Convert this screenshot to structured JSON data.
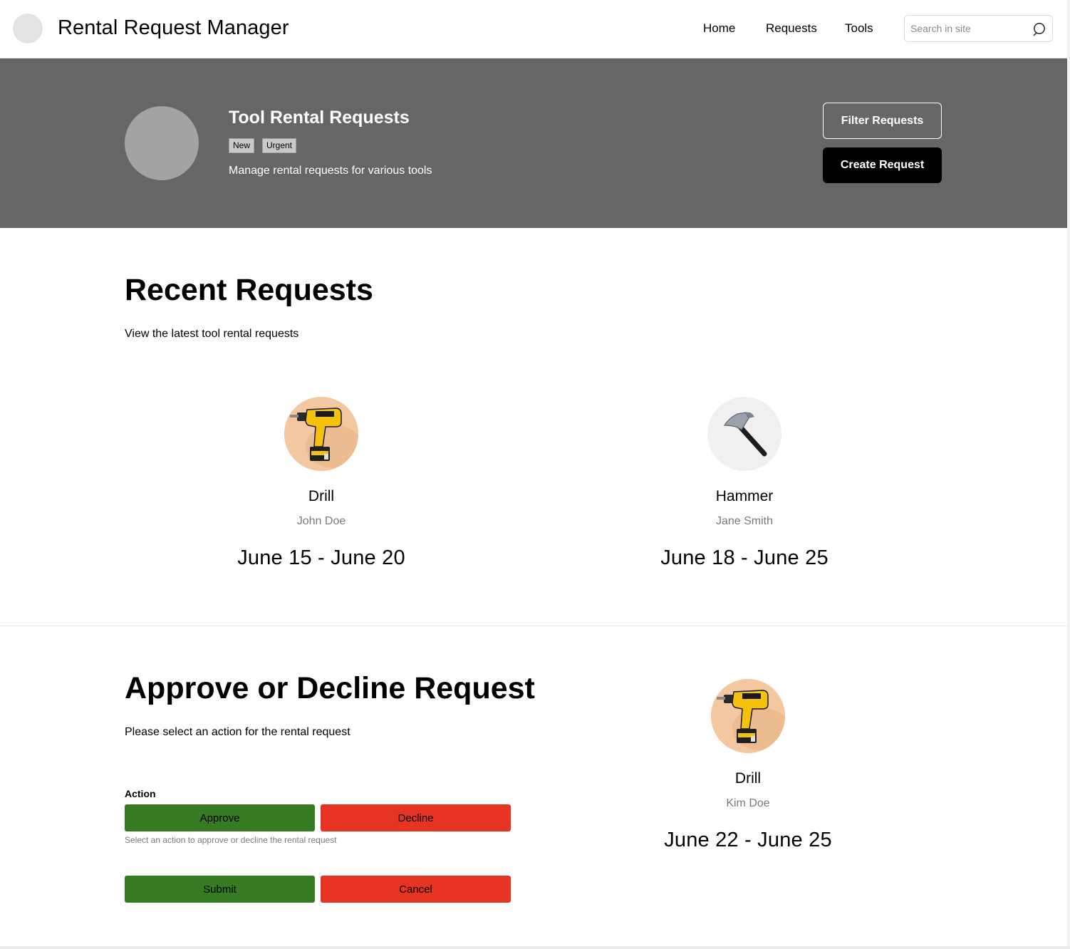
{
  "header": {
    "title": "Rental Request Manager",
    "nav": [
      "Home",
      "Requests",
      "Tools"
    ],
    "search_placeholder": "Search in site"
  },
  "hero": {
    "title": "Tool Rental Requests",
    "tags": [
      "New",
      "Urgent"
    ],
    "description": "Manage rental requests for various tools",
    "filter_label": "Filter Requests",
    "create_label": "Create Request"
  },
  "recent": {
    "title": "Recent Requests",
    "subtitle": "View the latest tool rental requests",
    "items": [
      {
        "tool": "Drill",
        "name": "John Doe",
        "dates": "June 15 - June 20",
        "icon": "drill-icon"
      },
      {
        "tool": "Hammer",
        "name": "Jane Smith",
        "dates": "June 18 - June 25",
        "icon": "hammer-icon"
      }
    ]
  },
  "approve": {
    "title": "Approve or Decline Request",
    "subtitle": "Please select an action for the rental request",
    "action_label": "Action",
    "approve_label": "Approve",
    "decline_label": "Decline",
    "help_text": "Select an action to approve or decline the rental request",
    "submit_label": "Submit",
    "cancel_label": "Cancel",
    "request": {
      "tool": "Drill",
      "name": "Kim Doe",
      "dates": "June 22 - June 25",
      "icon": "drill-icon"
    }
  },
  "colors": {
    "hero_bg": "#666666",
    "approve_green": "#367b22",
    "decline_red": "#e63322"
  }
}
